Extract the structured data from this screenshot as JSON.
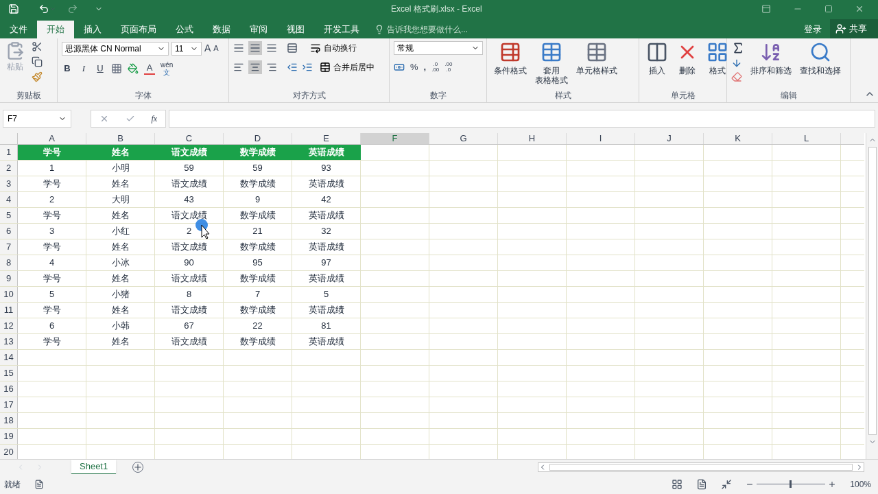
{
  "window": {
    "title": "Excel 格式刷.xlsx - Excel"
  },
  "tabs": [
    {
      "label": "文件",
      "selected": false
    },
    {
      "label": "开始",
      "selected": true
    },
    {
      "label": "插入",
      "selected": false
    },
    {
      "label": "页面布局",
      "selected": false
    },
    {
      "label": "公式",
      "selected": false
    },
    {
      "label": "数据",
      "selected": false
    },
    {
      "label": "审阅",
      "selected": false
    },
    {
      "label": "视图",
      "selected": false
    },
    {
      "label": "开发工具",
      "selected": false
    }
  ],
  "tell_me": {
    "placeholder": "告诉我您想要做什么..."
  },
  "account": {
    "login": "登录",
    "share": "共享"
  },
  "ribbon": {
    "clipboard": {
      "paste": "粘贴",
      "label": "剪贴板"
    },
    "font": {
      "name": "思源黑体 CN Normal",
      "size": "11",
      "grow": "A",
      "shrink": "A",
      "bold": "B",
      "italic": "I",
      "underline": "U",
      "color_letter": "A",
      "phonetic": [
        "wén",
        "文"
      ],
      "label": "字体"
    },
    "alignment": {
      "wrap": "自动换行",
      "merge": "合并后居中",
      "label": "对齐方式"
    },
    "number": {
      "format": "常规",
      "percent": "%",
      "comma": ",",
      "increase": [
        ".0",
        ".00"
      ],
      "decrease": [
        ".00",
        ".0"
      ],
      "label": "数字"
    },
    "styles": {
      "items": [
        [
          "条件格式"
        ],
        [
          "套用",
          "表格格式"
        ],
        [
          "单元格样式"
        ]
      ],
      "label": "样式"
    },
    "cells": {
      "items": [
        "插入",
        "删除",
        "格式"
      ],
      "label": "单元格"
    },
    "editing": {
      "items": [
        "排序和筛选",
        "查找和选择"
      ],
      "label": "编辑"
    }
  },
  "formula_bar": {
    "name_box": "F7",
    "fx": "fx"
  },
  "grid": {
    "columns": [
      {
        "label": "A",
        "selected": false
      },
      {
        "label": "B",
        "selected": false
      },
      {
        "label": "C",
        "selected": false
      },
      {
        "label": "D",
        "selected": false
      },
      {
        "label": "E",
        "selected": false
      },
      {
        "label": "F",
        "selected": true
      },
      {
        "label": "G",
        "selected": false
      },
      {
        "label": "H",
        "selected": false
      },
      {
        "label": "I",
        "selected": false
      },
      {
        "label": "J",
        "selected": false
      },
      {
        "label": "K",
        "selected": false
      },
      {
        "label": "L",
        "selected": false
      }
    ],
    "row_numbers": [
      "1",
      "2",
      "3",
      "4",
      "5",
      "6",
      "7",
      "8",
      "9",
      "10",
      "11",
      "12",
      "13",
      "14",
      "15",
      "16",
      "17",
      "18",
      "19",
      "20"
    ],
    "rows": [
      {
        "kind": "header",
        "cells": [
          "学号",
          "姓名",
          "语文成绩",
          "数学成绩",
          "英语成绩"
        ]
      },
      {
        "kind": "data",
        "cells": [
          "1",
          "小明",
          "59",
          "59",
          "93"
        ]
      },
      {
        "kind": "data",
        "cells": [
          "学号",
          "姓名",
          "语文成绩",
          "数学成绩",
          "英语成绩"
        ]
      },
      {
        "kind": "data",
        "cells": [
          "2",
          "大明",
          "43",
          "9",
          "42"
        ]
      },
      {
        "kind": "data",
        "cells": [
          "学号",
          "姓名",
          "语文成绩",
          "数学成绩",
          "英语成绩"
        ]
      },
      {
        "kind": "data",
        "cells": [
          "3",
          "小红",
          "2",
          "21",
          "32"
        ]
      },
      {
        "kind": "data",
        "cells": [
          "学号",
          "姓名",
          "语文成绩",
          "数学成绩",
          "英语成绩"
        ]
      },
      {
        "kind": "data",
        "cells": [
          "4",
          "小冰",
          "90",
          "95",
          "97"
        ]
      },
      {
        "kind": "data",
        "cells": [
          "学号",
          "姓名",
          "语文成绩",
          "数学成绩",
          "英语成绩"
        ]
      },
      {
        "kind": "data",
        "cells": [
          "5",
          "小猪",
          "8",
          "7",
          "5"
        ]
      },
      {
        "kind": "data",
        "cells": [
          "学号",
          "姓名",
          "语文成绩",
          "数学成绩",
          "英语成绩"
        ]
      },
      {
        "kind": "data",
        "cells": [
          "6",
          "小韩",
          "67",
          "22",
          "81"
        ]
      },
      {
        "kind": "data",
        "cells": [
          "学号",
          "姓名",
          "语文成绩",
          "数学成绩",
          "英语成绩"
        ]
      }
    ]
  },
  "sheets": [
    {
      "label": "Sheet1",
      "selected": true
    }
  ],
  "status_bar": {
    "status": "就绪",
    "zoom": "100%"
  }
}
